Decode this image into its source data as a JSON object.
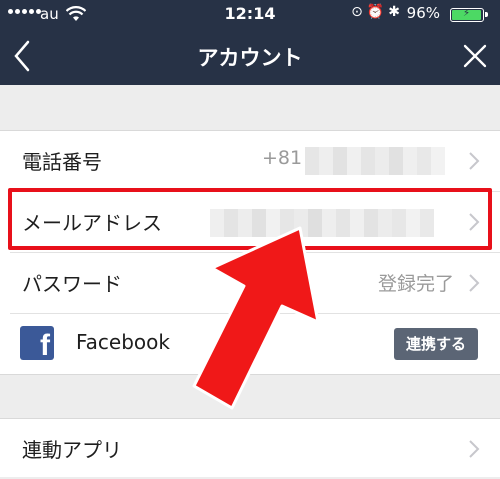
{
  "status_bar": {
    "carrier": "au",
    "time": "12:14",
    "battery_percent": "96%",
    "battery_level": 0.96,
    "icons": [
      "signal-dots-icon",
      "wifi-icon",
      "rotation-lock-icon",
      "alarm-icon",
      "bluetooth-icon",
      "battery-icon"
    ]
  },
  "nav": {
    "title": "アカウント",
    "back_icon": "chevron-left-icon",
    "close_icon": "close-icon"
  },
  "rows": {
    "phone": {
      "label": "電話番号",
      "value_prefix": "+81"
    },
    "email": {
      "label": "メールアドレス"
    },
    "password": {
      "label": "パスワード",
      "value": "登録完了"
    },
    "facebook": {
      "label": "Facebook",
      "button": "連携する"
    },
    "linked_apps": {
      "label": "連動アプリ"
    }
  },
  "colors": {
    "nav_bg": "#273246",
    "highlight": "#e8101a",
    "facebook": "#3b5998",
    "button_bg": "#5b6575",
    "battery": "#4cd964"
  }
}
